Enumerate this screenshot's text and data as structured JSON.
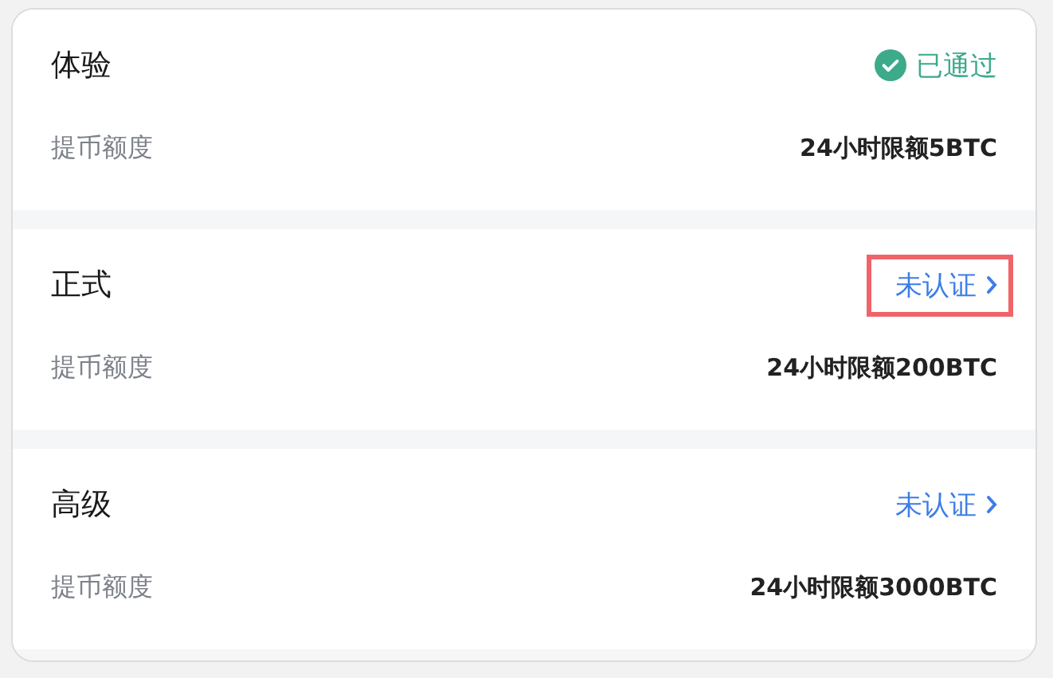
{
  "levels": [
    {
      "title": "体验",
      "status": {
        "kind": "passed",
        "label": "已通过",
        "highlighted": false
      },
      "limit_label": "提币额度",
      "limit_value": "24小时限额5BTC"
    },
    {
      "title": "正式",
      "status": {
        "kind": "unverified",
        "label": "未认证",
        "highlighted": true
      },
      "limit_label": "提币额度",
      "limit_value": "24小时限额200BTC"
    },
    {
      "title": "高级",
      "status": {
        "kind": "unverified",
        "label": "未认证",
        "highlighted": false
      },
      "limit_label": "提币额度",
      "limit_value": "24小时限额3000BTC"
    }
  ]
}
